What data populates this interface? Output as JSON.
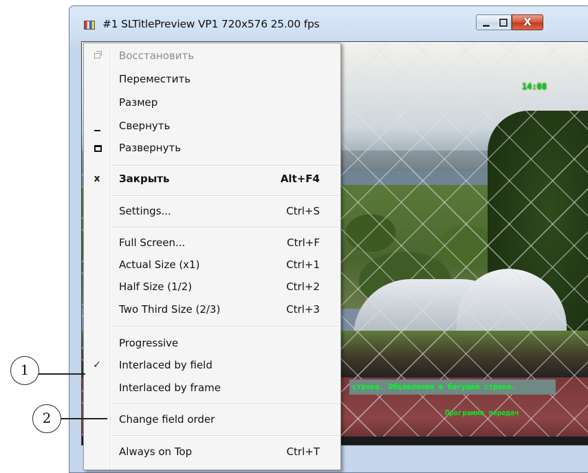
{
  "window": {
    "title": "#1 SLTitlePreview VP1 720x576 25.00 fps",
    "icon": "app-video-icon",
    "caption_buttons": [
      "minimize-icon",
      "maximize-icon",
      "close-icon"
    ],
    "close_glyph": "X"
  },
  "video": {
    "clock": "14:08",
    "crawl_text": "строке. Объявления в бегущей строке.",
    "program_text": "Программа передач"
  },
  "menu": {
    "restore": {
      "label": "Восстановить",
      "icon": "restore-icon",
      "disabled": true
    },
    "move": {
      "label": "Переместить"
    },
    "size": {
      "label": "Размер"
    },
    "minimize": {
      "label": "Свернуть",
      "icon": "minimize-icon"
    },
    "maximize": {
      "label": "Развернуть",
      "icon": "maximize-icon"
    },
    "close": {
      "label": "Закрыть",
      "shortcut": "Alt+F4",
      "icon": "close-icon",
      "icon_glyph": "x"
    },
    "settings": {
      "label": "Settings...",
      "shortcut": "Ctrl+S"
    },
    "full_screen": {
      "label": "Full Screen...",
      "shortcut": "Ctrl+F"
    },
    "actual_size": {
      "label": "Actual Size (x1)",
      "shortcut": "Ctrl+1"
    },
    "half_size": {
      "label": "Half Size (1/2)",
      "shortcut": "Ctrl+2"
    },
    "two_third_size": {
      "label": "Two Third Size (2/3)",
      "shortcut": "Ctrl+3"
    },
    "progressive": {
      "label": "Progressive"
    },
    "interlaced_field": {
      "label": "Interlaced by field",
      "checked": true,
      "check_glyph": "✓"
    },
    "interlaced_frame": {
      "label": "Interlaced by frame"
    },
    "change_field_order": {
      "label": "Change field order"
    },
    "always_on_top": {
      "label": "Always on Top",
      "shortcut": "Ctrl+T"
    }
  },
  "callouts": {
    "one": "1",
    "two": "2"
  },
  "colors": {
    "check_accent": "#1c55c8",
    "close_button": "#c9452a",
    "overlay_text": "#00ff22"
  }
}
